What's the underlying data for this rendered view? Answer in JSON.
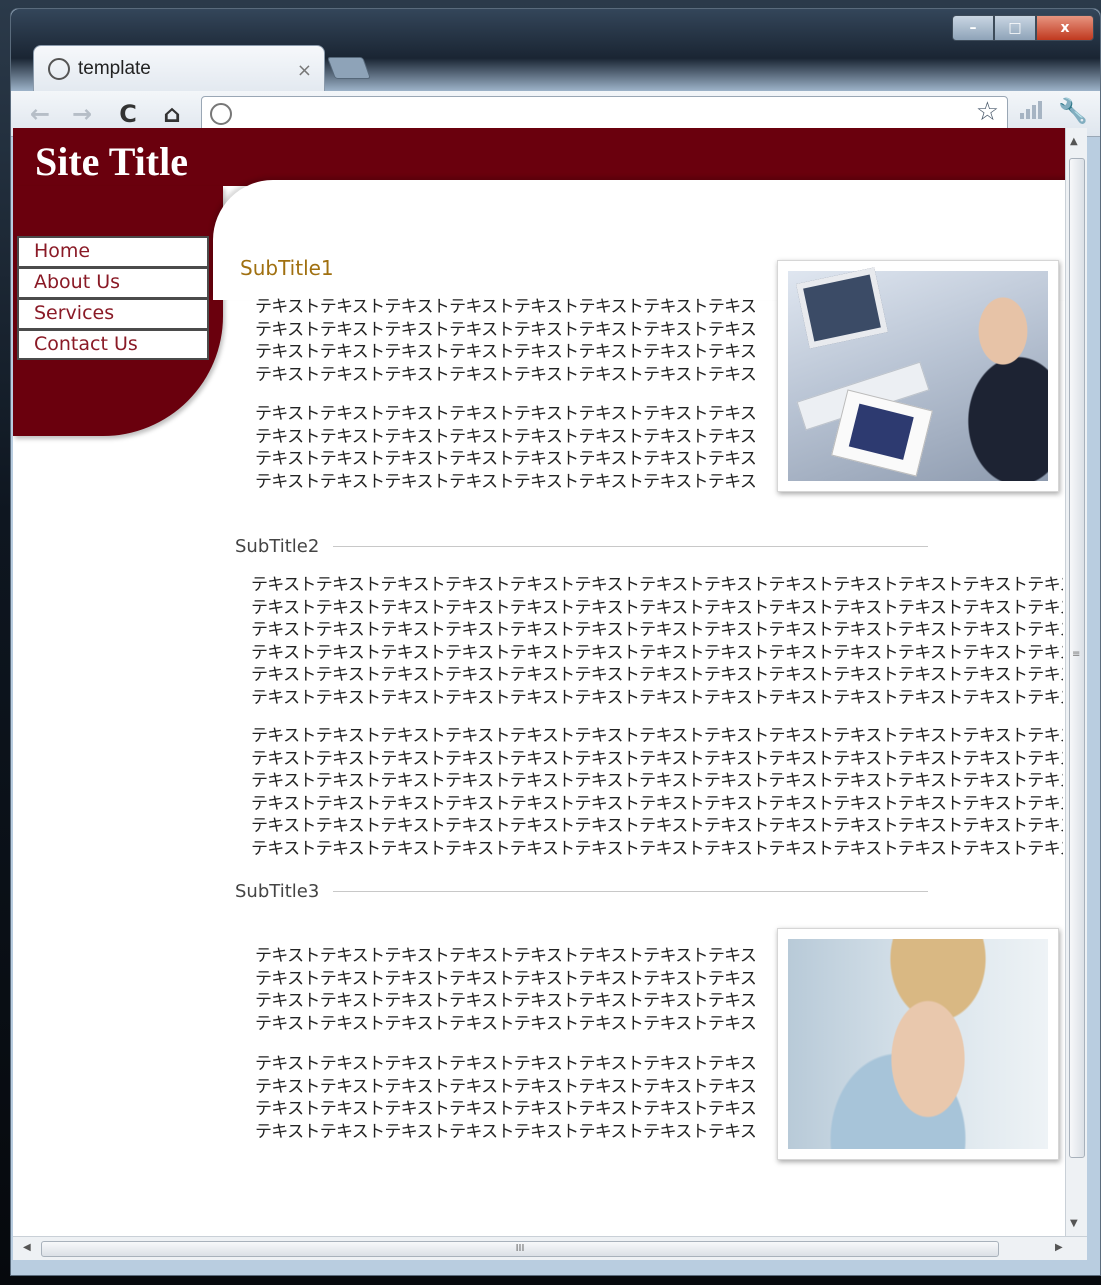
{
  "browser": {
    "tab_title": "template",
    "tab_close": "×",
    "address": "",
    "nav": {
      "back": "←",
      "forward": "→",
      "reload": "C",
      "home": "⌂"
    },
    "window_controls": {
      "minimize": "–",
      "maximize": "□",
      "close": "x"
    },
    "icons": {
      "star": "☆",
      "wrench": "🔧"
    }
  },
  "site": {
    "title": "Site Title",
    "colors": {
      "brand": "#6a000d",
      "subtitle1": "#a07010"
    }
  },
  "menu": {
    "items": [
      {
        "label": "Home"
      },
      {
        "label": "About Us"
      },
      {
        "label": "Services"
      },
      {
        "label": "Contact Us"
      }
    ]
  },
  "content": {
    "subtitle1": "SubTitle1",
    "subtitle2": "SubTitle2",
    "subtitle3": "SubTitle3",
    "s1_para1": "テキストテキストテキストテキストテキストテキストテキストテキスト\nテキストテキストテキストテキストテキストテキストテキストテキスト\nテキストテキストテキストテキストテキストテキストテキストテキスト\nテキストテキストテキストテキストテキストテキストテキストテキスト",
    "s1_para2": "テキストテキストテキストテキストテキストテキストテキストテキスト\nテキストテキストテキストテキストテキストテキストテキストテキスト\nテキストテキストテキストテキストテキストテキストテキストテキスト\nテキストテキストテキストテキストテキストテキストテキストテキスト",
    "s2_para1": "テキストテキストテキストテキストテキストテキストテキストテキストテキストテキストテキストテキストテキスト\nテキストテキストテキストテキストテキストテキストテキストテキストテキストテキストテキストテキストテキスト\nテキストテキストテキストテキストテキストテキストテキストテキストテキストテキストテキストテキストテキスト\nテキストテキストテキストテキストテキストテキストテキストテキストテキストテキストテキストテキストテキスト\nテキストテキストテキストテキストテキストテキストテキストテキストテキストテキストテキストテキストテキスト\nテキストテキストテキストテキストテキストテキストテキストテキストテキストテキストテキストテキストテキスト",
    "s2_para2": "テキストテキストテキストテキストテキストテキストテキストテキストテキストテキストテキストテキストテキスト\nテキストテキストテキストテキストテキストテキストテキストテキストテキストテキストテキストテキストテキスト\nテキストテキストテキストテキストテキストテキストテキストテキストテキストテキストテキストテキストテキスト\nテキストテキストテキストテキストテキストテキストテキストテキストテキストテキストテキストテキストテキスト\nテキストテキストテキストテキストテキストテキストテキストテキストテキストテキストテキストテキストテキスト\nテキストテキストテキストテキストテキストテキストテキストテキストテキストテキストテキストテキストテキスト",
    "s3_para1": "テキストテキストテキストテキストテキストテキストテキストテキスト\nテキストテキストテキストテキストテキストテキストテキストテキスト\nテキストテキストテキストテキストテキストテキストテキストテキスト\nテキストテキストテキストテキストテキストテキストテキストテキスト",
    "s3_para2": "テキストテキストテキストテキストテキストテキストテキストテキスト\nテキストテキストテキストテキストテキストテキストテキストテキスト\nテキストテキストテキストテキストテキストテキストテキストテキスト\nテキストテキストテキストテキストテキストテキストテキストテキスト"
  },
  "scrollbar": {
    "grip": "≡",
    "h_grip": "III",
    "up": "▲",
    "down": "▼",
    "left": "◀",
    "right": "▶"
  }
}
